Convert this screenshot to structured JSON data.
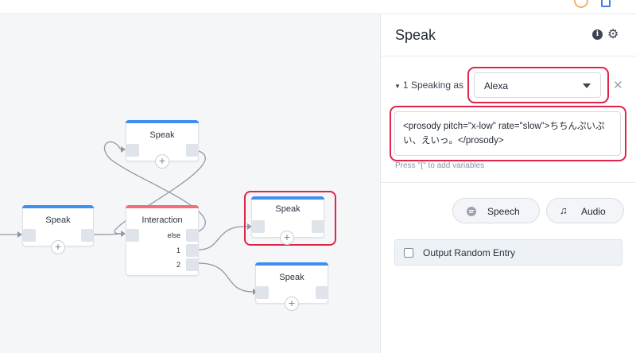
{
  "topbar": {
    "icons": [
      "status-icon",
      "document-icon"
    ]
  },
  "canvas": {
    "nodes": {
      "speak_left": {
        "title": "Speak"
      },
      "speak_top": {
        "title": "Speak"
      },
      "interaction": {
        "title": "Interaction",
        "ports": [
          "else",
          "1",
          "2"
        ]
      },
      "speak_selected": {
        "title": "Speak"
      },
      "speak_bottom": {
        "title": "Speak"
      }
    },
    "plus_symbol": "+"
  },
  "panel": {
    "title": "Speak",
    "speaking_section": {
      "index": "1",
      "label": "Speaking as",
      "selected_voice": "Alexa"
    },
    "ssml_text": "<prosody pitch=\"x-low\" rate=\"slow\">ちちんぷいぷい、えいっ。</prosody>",
    "variables_hint": "Press \"{\" to add variables",
    "buttons": {
      "speech_label": "Speech",
      "audio_label": "Audio"
    },
    "output_random_label": "Output Random Entry"
  },
  "colors": {
    "speak_accent": "#3f8ef0",
    "interaction_accent": "#ef6f7c",
    "highlight": "#e0244a"
  }
}
